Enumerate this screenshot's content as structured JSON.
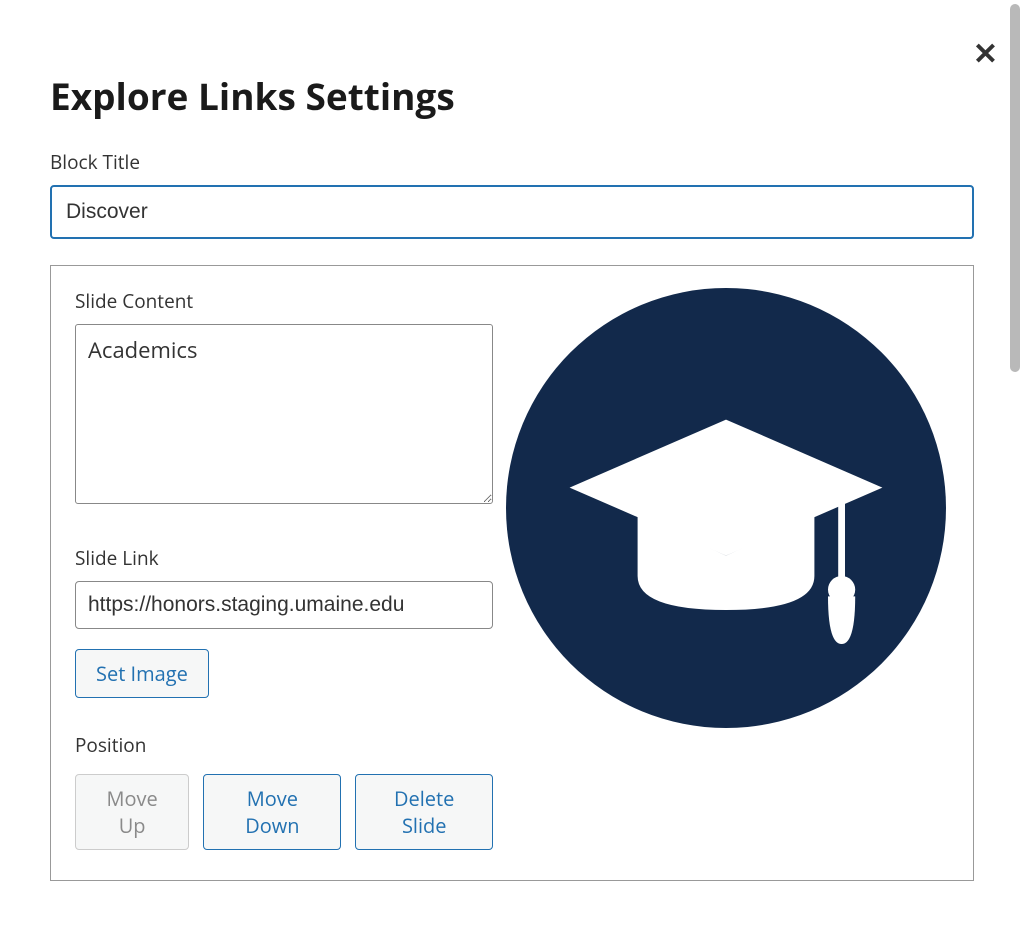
{
  "header": {
    "title": "Explore Links Settings"
  },
  "block_title": {
    "label": "Block Title",
    "value": "Discover"
  },
  "slide": {
    "content_label": "Slide Content",
    "content_value": "Academics",
    "link_label": "Slide Link",
    "link_value": "https://honors.staging.umaine.edu",
    "set_image_label": "Set Image",
    "image_icon": "graduation-cap",
    "image_bg_color": "#12294b"
  },
  "position": {
    "label": "Position",
    "move_up_label": "Move Up",
    "move_down_label": "Move Down",
    "delete_label": "Delete Slide"
  },
  "close_label": "✕"
}
